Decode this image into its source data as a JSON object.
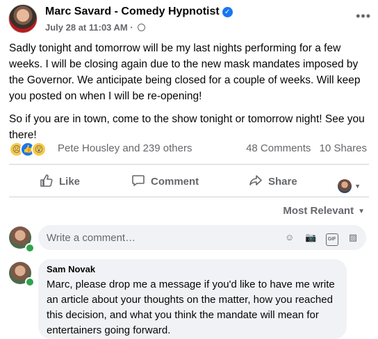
{
  "post": {
    "author": "Marc Savard - Comedy Hypnotist",
    "timestamp": "July 28 at 11:03 AM",
    "separator": "·",
    "paragraphs": [
      "Sadly tonight and tomorrow will be my last nights performing for a few weeks.  I will be closing again due to the new mask mandates imposed by the Governor.  We anticipate being closed for a couple of weeks.  Will keep you posted on when I will be re-opening!",
      "So if you are in town, come to the show tonight or tomorrow night! See you there!"
    ]
  },
  "reactions": {
    "icons": [
      "sad",
      "like",
      "wow"
    ],
    "names": "Pete Housley and 239 others",
    "comments": "48 Comments",
    "shares": "10 Shares"
  },
  "actions": {
    "like": "Like",
    "comment": "Comment",
    "share": "Share"
  },
  "comments_section": {
    "sort_label": "Most Relevant",
    "write_placeholder": "Write a comment…",
    "comments": [
      {
        "author": "Sam Novak",
        "text": "Marc, please drop me a message if you'd like to have me write an article about your thoughts on the matter, how you reached this decision, and what you think the mandate will mean for entertainers going forward."
      }
    ]
  },
  "colors": {
    "accent": "#1877f2",
    "muted_text": "#65676b",
    "online": "#31a24c",
    "bubble": "#f0f2f5"
  }
}
